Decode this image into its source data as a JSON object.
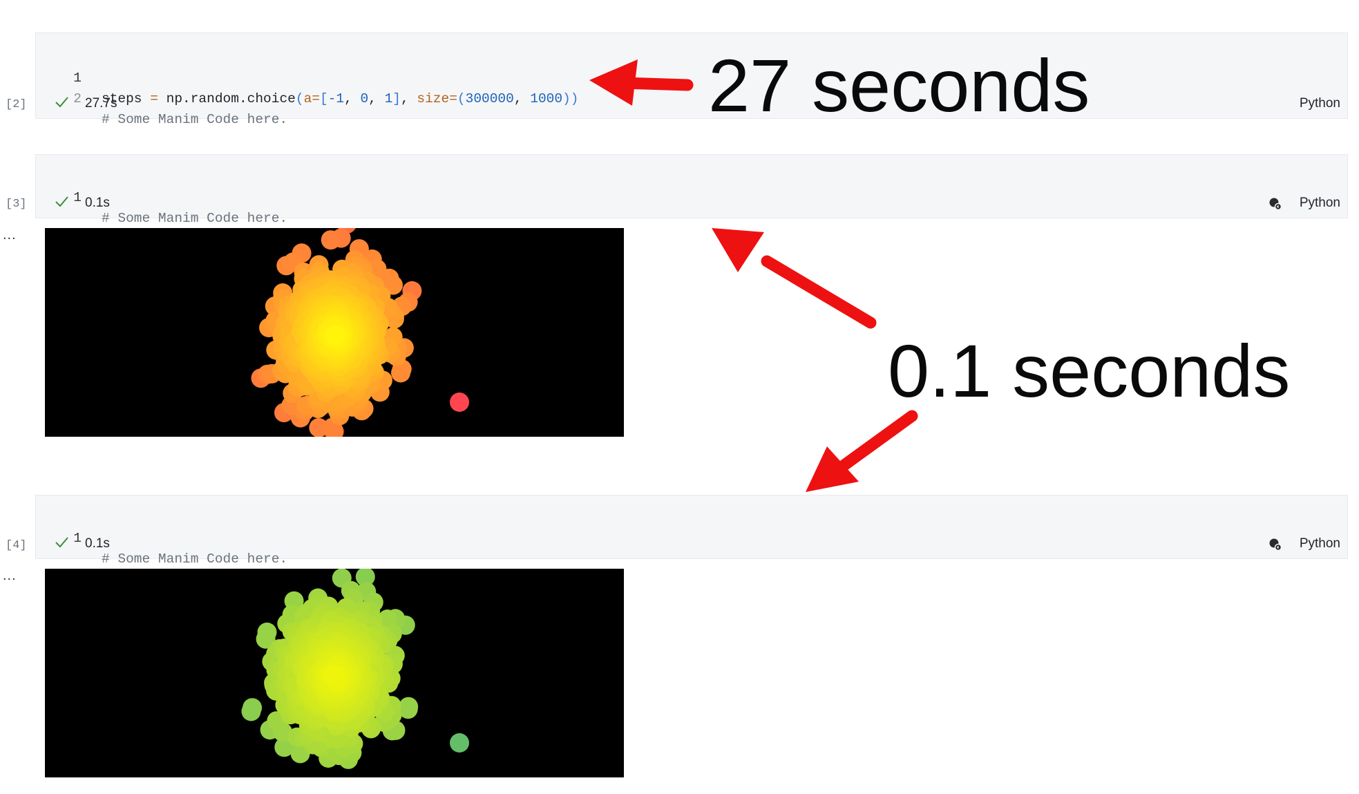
{
  "cells": [
    {
      "exec_count": "[2]",
      "lines": [
        {
          "num": "1",
          "tokens": [
            {
              "t": "steps ",
              "c": ""
            },
            {
              "t": "=",
              "c": "kw"
            },
            {
              "t": " np.random.choice",
              "c": ""
            },
            {
              "t": "(",
              "c": "br"
            },
            {
              "t": "a",
              "c": "kw"
            },
            {
              "t": "=",
              "c": "kw"
            },
            {
              "t": "[",
              "c": "br"
            },
            {
              "t": "-1",
              "c": "num"
            },
            {
              "t": ", ",
              "c": ""
            },
            {
              "t": "0",
              "c": "num"
            },
            {
              "t": ", ",
              "c": ""
            },
            {
              "t": "1",
              "c": "num"
            },
            {
              "t": "]",
              "c": "br"
            },
            {
              "t": ", ",
              "c": ""
            },
            {
              "t": "size",
              "c": "kw"
            },
            {
              "t": "=",
              "c": "kw"
            },
            {
              "t": "(",
              "c": "br"
            },
            {
              "t": "300000",
              "c": "num"
            },
            {
              "t": ", ",
              "c": ""
            },
            {
              "t": "1000",
              "c": "num"
            },
            {
              "t": "))",
              "c": "br"
            }
          ]
        },
        {
          "num": "2",
          "tokens": [
            {
              "t": "# Some Manim Code here.",
              "c": "cmt"
            }
          ]
        }
      ],
      "time": "27.7s",
      "language": "Python",
      "kernel_icon": false
    },
    {
      "exec_count": "[3]",
      "lines": [
        {
          "num": "1",
          "tokens": [
            {
              "t": "# Some Manim Code here.",
              "c": "cmt"
            }
          ]
        }
      ],
      "time": "0.1s",
      "language": "Python",
      "kernel_icon": true,
      "output_dots": "...",
      "output_palette": "warm"
    },
    {
      "exec_count": "[4]",
      "lines": [
        {
          "num": "1",
          "tokens": [
            {
              "t": "# Some Manim Code here.",
              "c": "cmt"
            }
          ]
        }
      ],
      "time": "0.1s",
      "language": "Python",
      "kernel_icon": true,
      "output_dots": "...",
      "output_palette": "green"
    }
  ],
  "annotations": {
    "slow": "27 seconds",
    "fast": "0.1 seconds",
    "arrow_color": "#ee1111"
  },
  "icons": {
    "check": "checkmark-icon",
    "kernel": "kernel-status-icon",
    "more": "more-horizontal-icon"
  },
  "colors": {
    "check_green": "#3a8f3a",
    "cell_bg": "#f5f6f8"
  }
}
